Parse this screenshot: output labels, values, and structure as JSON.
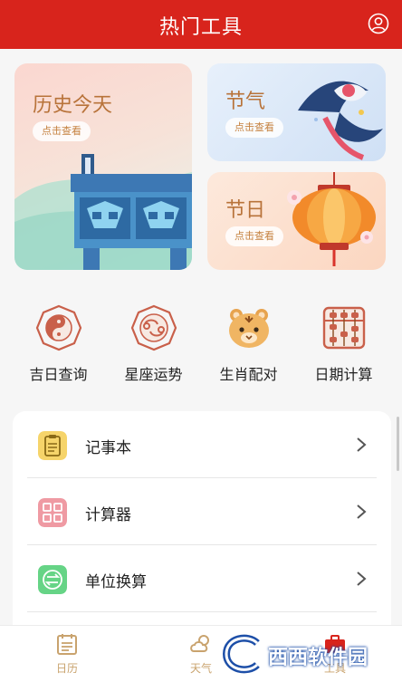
{
  "header": {
    "title": "热门工具"
  },
  "cards": {
    "history": {
      "title": "历史今天",
      "action": "点击查看"
    },
    "solar_terms": {
      "title": "节气",
      "action": "点击查看"
    },
    "festivals": {
      "title": "节日",
      "action": "点击查看"
    }
  },
  "quick_tools": [
    {
      "label": "吉日查询",
      "icon": "yin-yang-icon"
    },
    {
      "label": "星座运势",
      "icon": "zodiac-icon"
    },
    {
      "label": "生肖配对",
      "icon": "tiger-icon"
    },
    {
      "label": "日期计算",
      "icon": "abacus-icon"
    }
  ],
  "tool_list": [
    {
      "label": "记事本",
      "icon": "notepad-icon",
      "color": "#f3c84e"
    },
    {
      "label": "计算器",
      "icon": "calculator-icon",
      "color": "#ef8c97"
    },
    {
      "label": "单位换算",
      "icon": "unit-convert-icon",
      "color": "#5ccf7c"
    }
  ],
  "tabbar": [
    {
      "label": "日历",
      "icon": "calendar-icon"
    },
    {
      "label": "天气",
      "icon": "weather-icon"
    },
    {
      "label": "工具",
      "icon": "toolbox-icon"
    }
  ],
  "watermark": {
    "text": "西西软件园"
  },
  "colors": {
    "brand_red": "#d8241c",
    "gold": "#b8733a",
    "tab_gold": "#c9a36e"
  }
}
